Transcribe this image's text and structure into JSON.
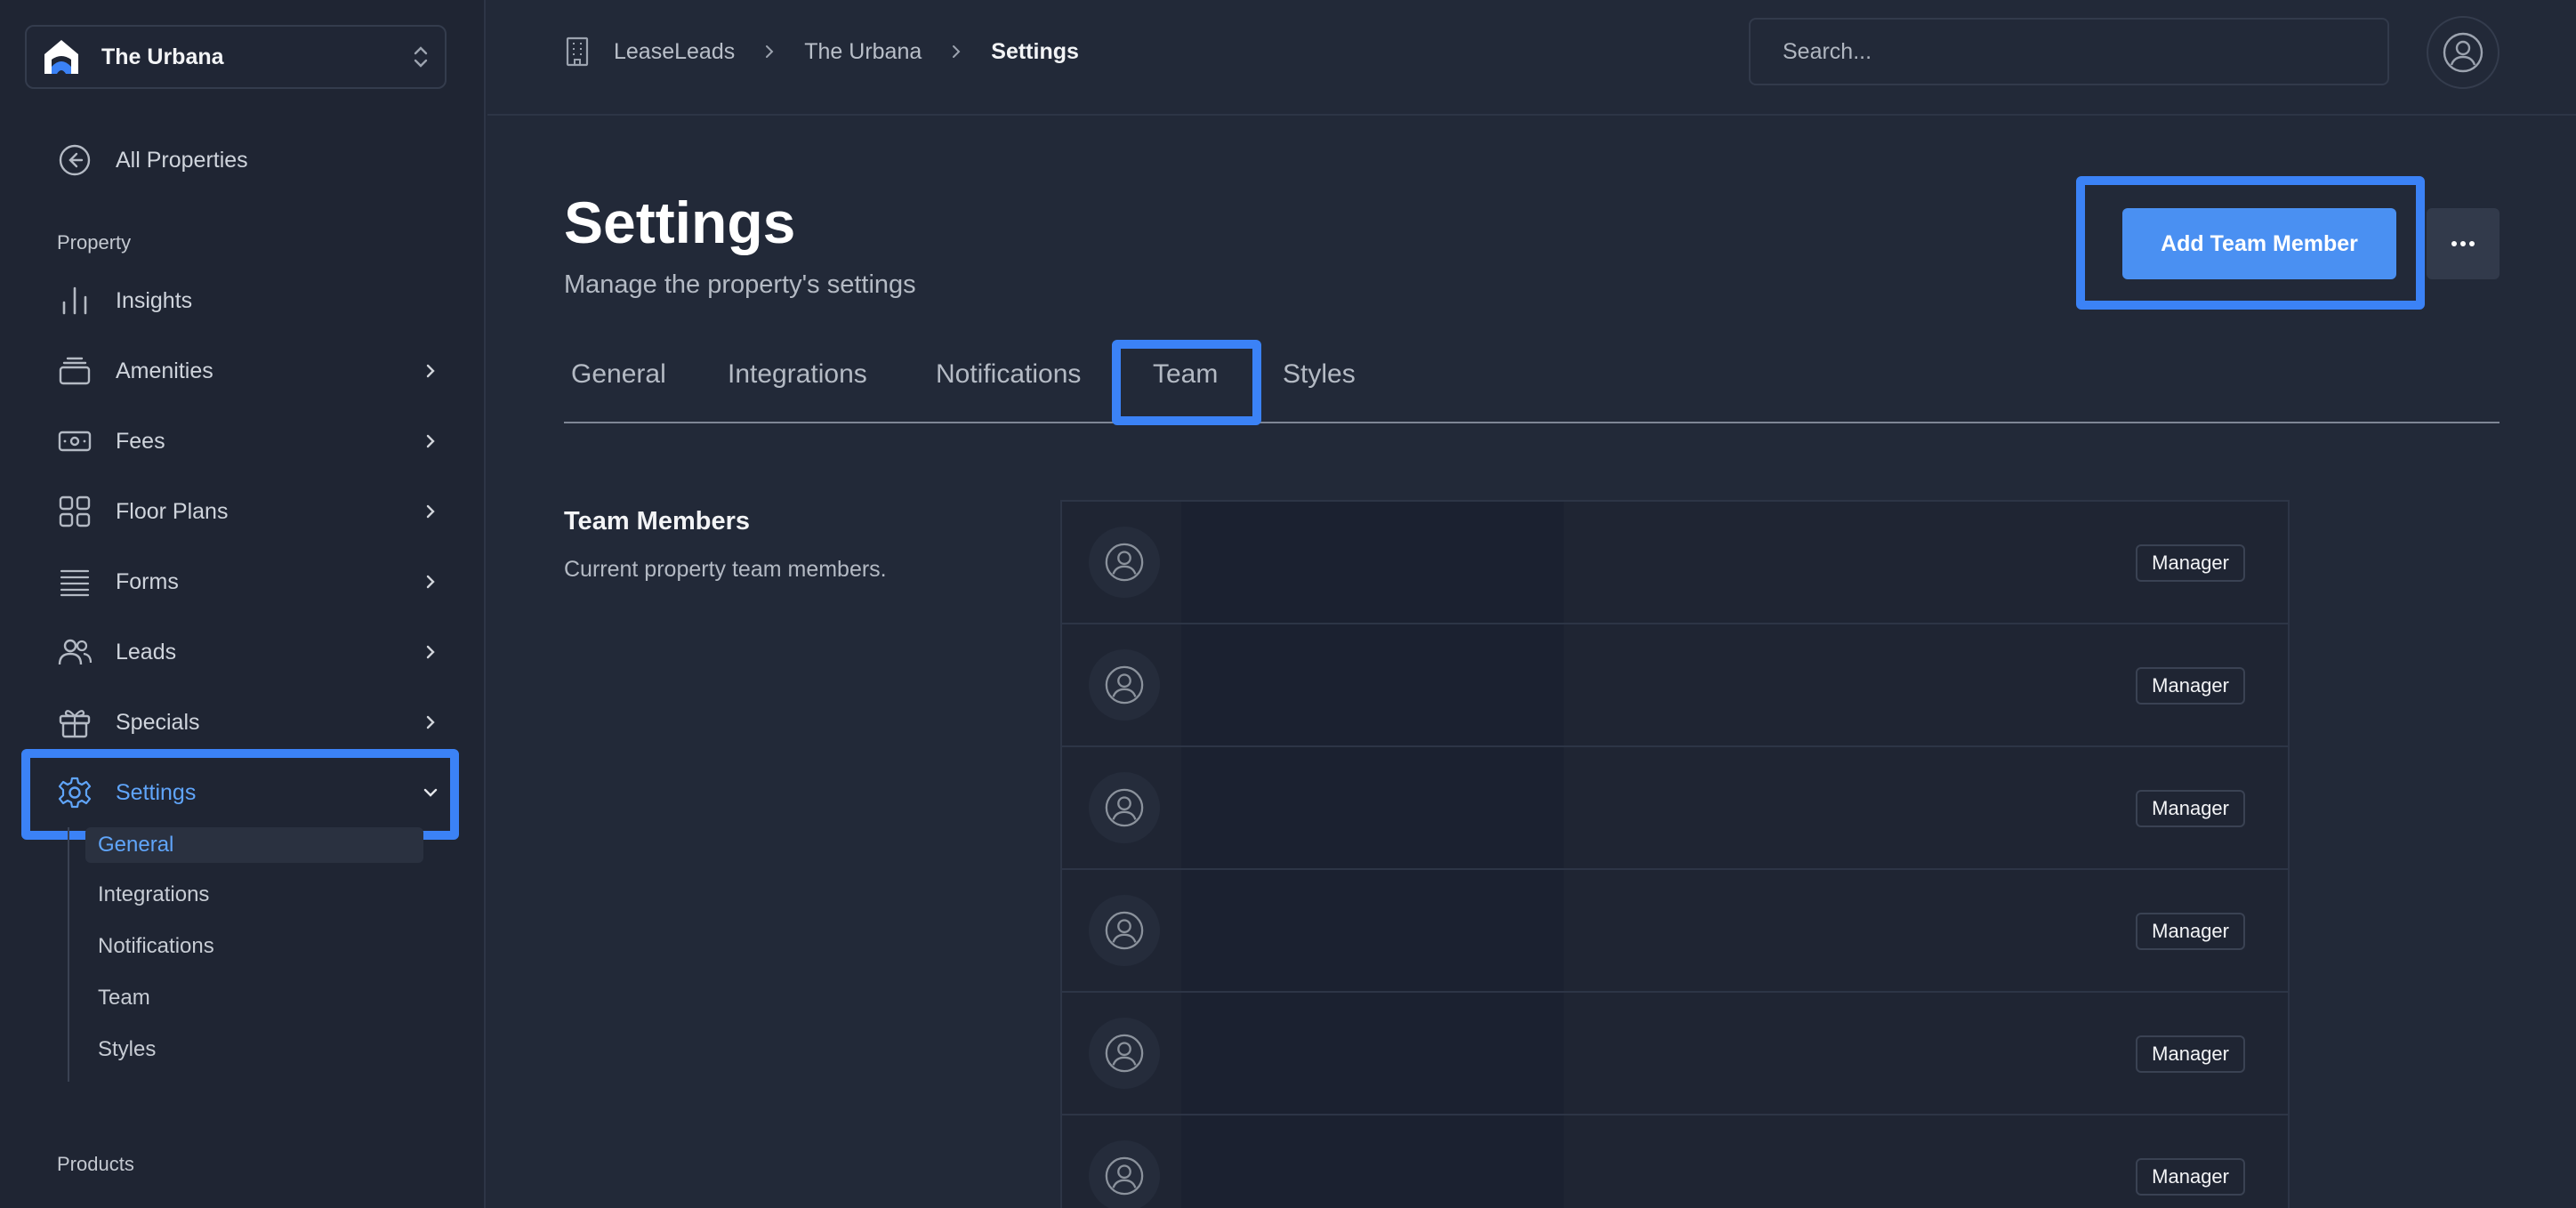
{
  "property_switcher": {
    "name": "The Urbana"
  },
  "sidebar": {
    "back_label": "All Properties",
    "section_property": "Property",
    "items": [
      {
        "label": "Insights",
        "icon": "chart-bars-icon",
        "has_chevron": false
      },
      {
        "label": "Amenities",
        "icon": "stack-icon",
        "has_chevron": true
      },
      {
        "label": "Fees",
        "icon": "banknote-icon",
        "has_chevron": true
      },
      {
        "label": "Floor Plans",
        "icon": "grid-icon",
        "has_chevron": true
      },
      {
        "label": "Forms",
        "icon": "list-icon",
        "has_chevron": true
      },
      {
        "label": "Leads",
        "icon": "users-icon",
        "has_chevron": true
      },
      {
        "label": "Specials",
        "icon": "gift-icon",
        "has_chevron": true
      },
      {
        "label": "Settings",
        "icon": "gear-icon",
        "has_chevron": true,
        "expanded": true
      }
    ],
    "settings_subitems": [
      "General",
      "Integrations",
      "Notifications",
      "Team",
      "Styles"
    ],
    "section_products": "Products"
  },
  "breadcrumb": [
    "LeaseLeads",
    "The Urbana",
    "Settings"
  ],
  "search": {
    "placeholder": "Search..."
  },
  "page": {
    "title": "Settings",
    "subtitle": "Manage the property's settings",
    "primary_action": "Add Team Member",
    "more_action": "···"
  },
  "tabs": [
    "General",
    "Integrations",
    "Notifications",
    "Team",
    "Styles"
  ],
  "team_section": {
    "title": "Team Members",
    "description": "Current property team members.",
    "members": [
      {
        "role": "Manager"
      },
      {
        "role": "Manager"
      },
      {
        "role": "Manager"
      },
      {
        "role": "Manager"
      },
      {
        "role": "Manager"
      },
      {
        "role": "Manager"
      }
    ]
  },
  "colors": {
    "accent": "#3b82f6",
    "primary_button": "#4a90f2",
    "active_text": "#60a5fa",
    "background": "#222938",
    "sidebar": "#1f2533"
  }
}
